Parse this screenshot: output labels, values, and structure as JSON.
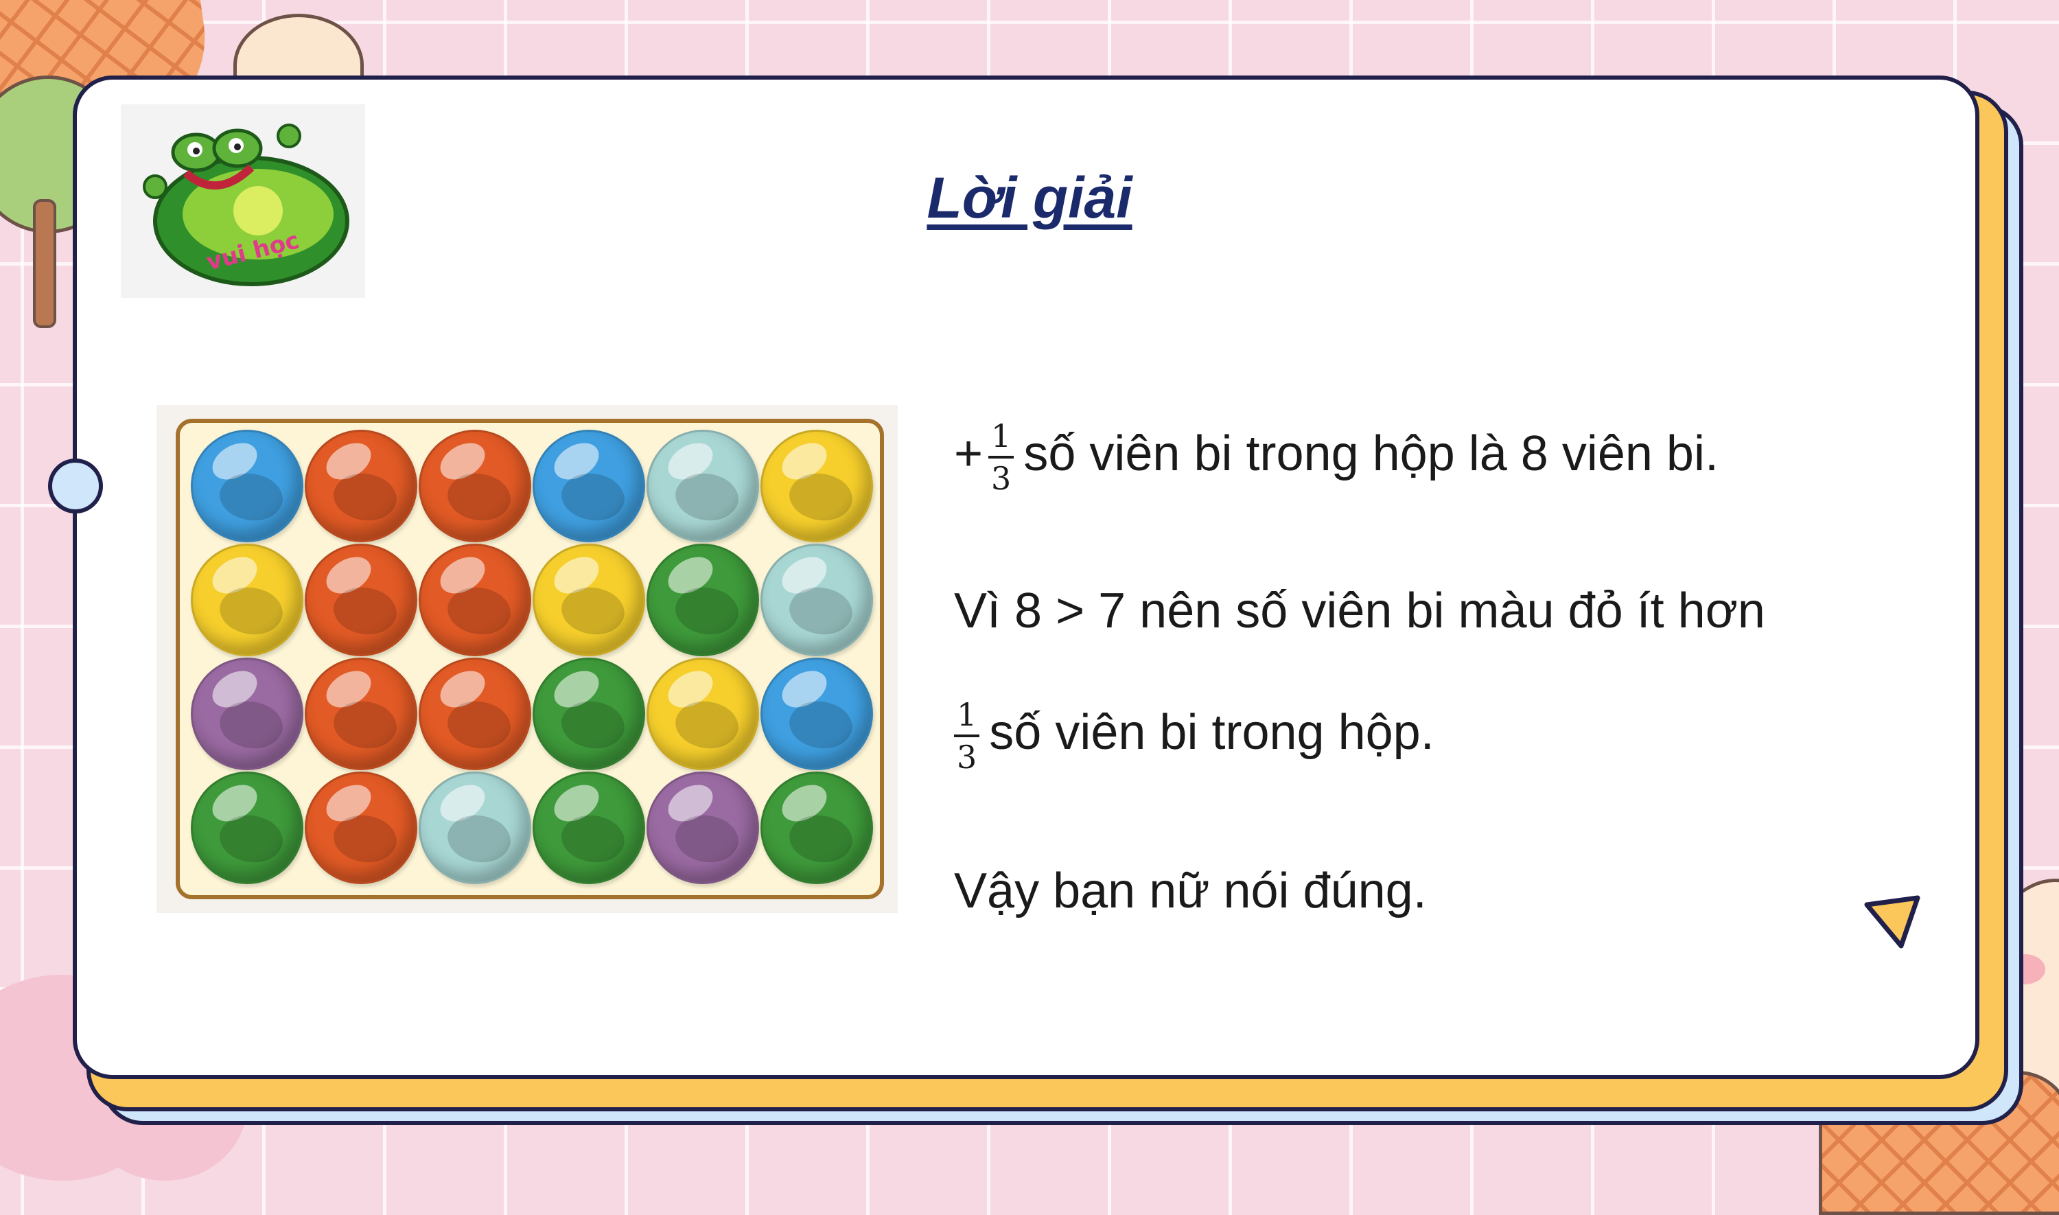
{
  "slide": {
    "title": "Lời giải",
    "logo_icon": "frog-lily-pad-logo",
    "logo_text": "vui học"
  },
  "marbles": {
    "rows": [
      [
        "blue",
        "red",
        "red",
        "blue",
        "teal",
        "yellow"
      ],
      [
        "yellow",
        "red",
        "red",
        "yellow",
        "green",
        "teal"
      ],
      [
        "purple",
        "red",
        "red",
        "green",
        "yellow",
        "blue"
      ],
      [
        "green",
        "red",
        "teal",
        "green",
        "purple",
        "green"
      ]
    ]
  },
  "colors": {
    "blue": "#3f9fe0",
    "red": "#e25a25",
    "yellow": "#f6cf2c",
    "green": "#3e9a3a",
    "teal": "#a7d6d3",
    "purple": "#9a6aa2",
    "card_border": "#20204a",
    "title": "#1a2a6b",
    "accent_yellow": "#fbc65a",
    "accent_blue": "#cfe6fb"
  },
  "lines": [
    {
      "prefix": "+",
      "fraction": {
        "num": "1",
        "den": "3"
      },
      "text": "số viên bi trong hộp là 8 viên bi."
    },
    {
      "prefix": "",
      "fraction": null,
      "text": "Vì 8 > 7 nên số viên bi màu đỏ ít hơn"
    },
    {
      "prefix": "",
      "fraction": {
        "num": "1",
        "den": "3"
      },
      "text": "số viên bi trong hộp."
    },
    {
      "prefix": "",
      "fraction": null,
      "text": "Vậy bạn nữ nói đúng."
    }
  ],
  "decorations": {
    "next_icon": "triangle-play-icon",
    "binder_ring": "ring-icon"
  }
}
